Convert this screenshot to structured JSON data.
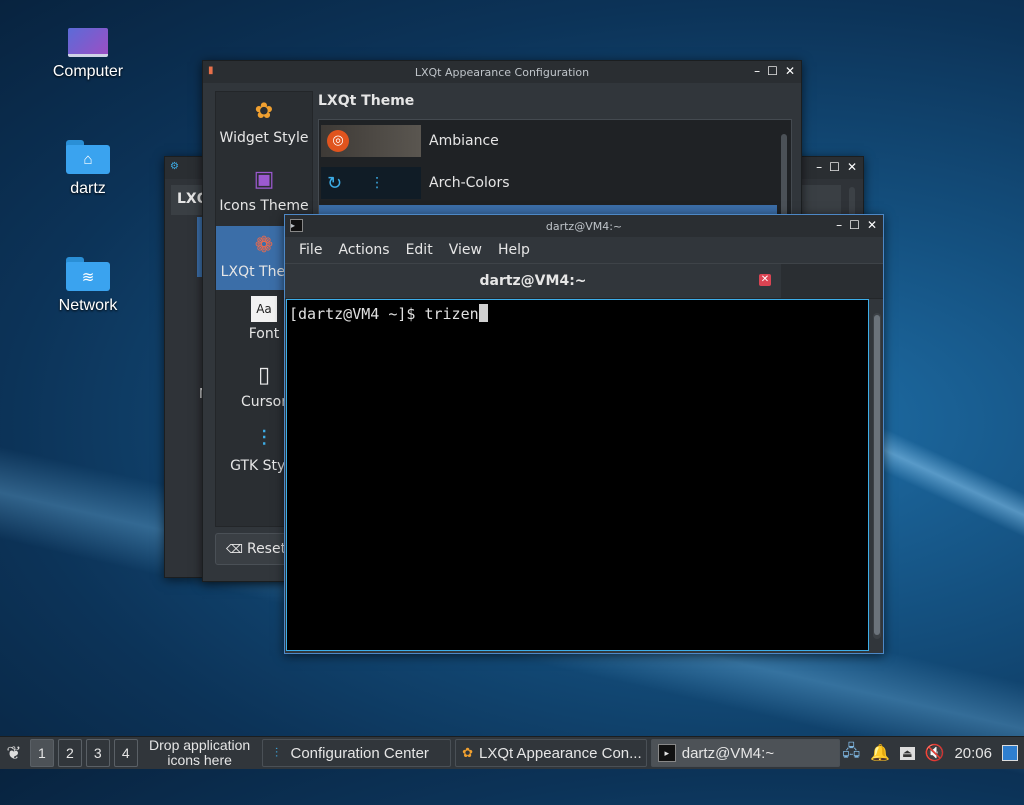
{
  "desktop": {
    "icons": [
      {
        "label": "Computer"
      },
      {
        "label": "dartz"
      },
      {
        "label": "Network"
      }
    ]
  },
  "back_window": {
    "partial_text": "LXQ",
    "partial_side": "N"
  },
  "appearance_window": {
    "title": "LXQt Appearance Configuration",
    "sidebar": [
      {
        "label": "Widget Style"
      },
      {
        "label": "Icons Theme"
      },
      {
        "label": "LXQt Theme"
      },
      {
        "label": "Font"
      },
      {
        "label": "Cursor"
      },
      {
        "label": "GTK Style"
      }
    ],
    "selected": "LXQt Theme",
    "heading": "LXQt Theme",
    "themes": [
      {
        "name": "Ambiance"
      },
      {
        "name": "Arch-Colors"
      }
    ],
    "reset_label": "Reset"
  },
  "terminal": {
    "title": "dartz@VM4:~",
    "menu": [
      "File",
      "Actions",
      "Edit",
      "View",
      "Help"
    ],
    "tab_title": "dartz@VM4:~",
    "prompt": "[dartz@VM4 ~]$ ",
    "command": "trizen"
  },
  "taskbar": {
    "workspaces": [
      "1",
      "2",
      "3",
      "4"
    ],
    "quicklaunch_text": "Drop application icons here",
    "tasks": [
      {
        "label": "Configuration Center"
      },
      {
        "label": "LXQt Appearance Con..."
      },
      {
        "label": "dartz@VM4:~"
      }
    ],
    "clock": "20:06"
  },
  "colors": {
    "accent": "#3daee9",
    "selection": "#3b6ea8",
    "close_red": "#da4453"
  }
}
